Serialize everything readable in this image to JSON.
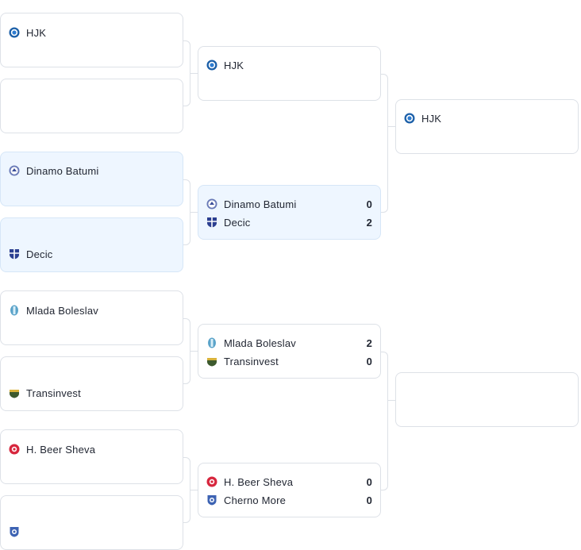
{
  "round1": [
    {
      "team": "HJK",
      "logo": "hjk-logo-icon"
    },
    {
      "team": "",
      "logo": ""
    },
    {
      "team": "Dinamo Batumi",
      "logo": "dinamo-batumi-logo-icon"
    },
    {
      "team": "Decic",
      "logo": "decic-logo-icon"
    },
    {
      "team": "Mlada Boleslav",
      "logo": "mlada-boleslav-logo-icon"
    },
    {
      "team": "Transinvest",
      "logo": "transinvest-logo-icon"
    },
    {
      "team": "H. Beer Sheva",
      "logo": "beer-sheva-logo-icon"
    },
    {
      "team": "",
      "logo": "cherno-more-logo-icon"
    }
  ],
  "round2": [
    {
      "home": {
        "team": "HJK",
        "score": ""
      },
      "away": {
        "team": "",
        "score": ""
      }
    },
    {
      "home": {
        "team": "Dinamo Batumi",
        "score": "0"
      },
      "away": {
        "team": "Decic",
        "score": "2"
      }
    },
    {
      "home": {
        "team": "Mlada Boleslav",
        "score": "2"
      },
      "away": {
        "team": "Transinvest",
        "score": "0"
      }
    },
    {
      "home": {
        "team": "H. Beer Sheva",
        "score": "0"
      },
      "away": {
        "team": "Cherno More",
        "score": "0"
      }
    }
  ],
  "round3": [
    {
      "team": "HJK"
    },
    {
      "team": ""
    }
  ],
  "colors": {
    "border": "#dde1e7",
    "highlight": "#eef6ff",
    "text": "#222733"
  }
}
